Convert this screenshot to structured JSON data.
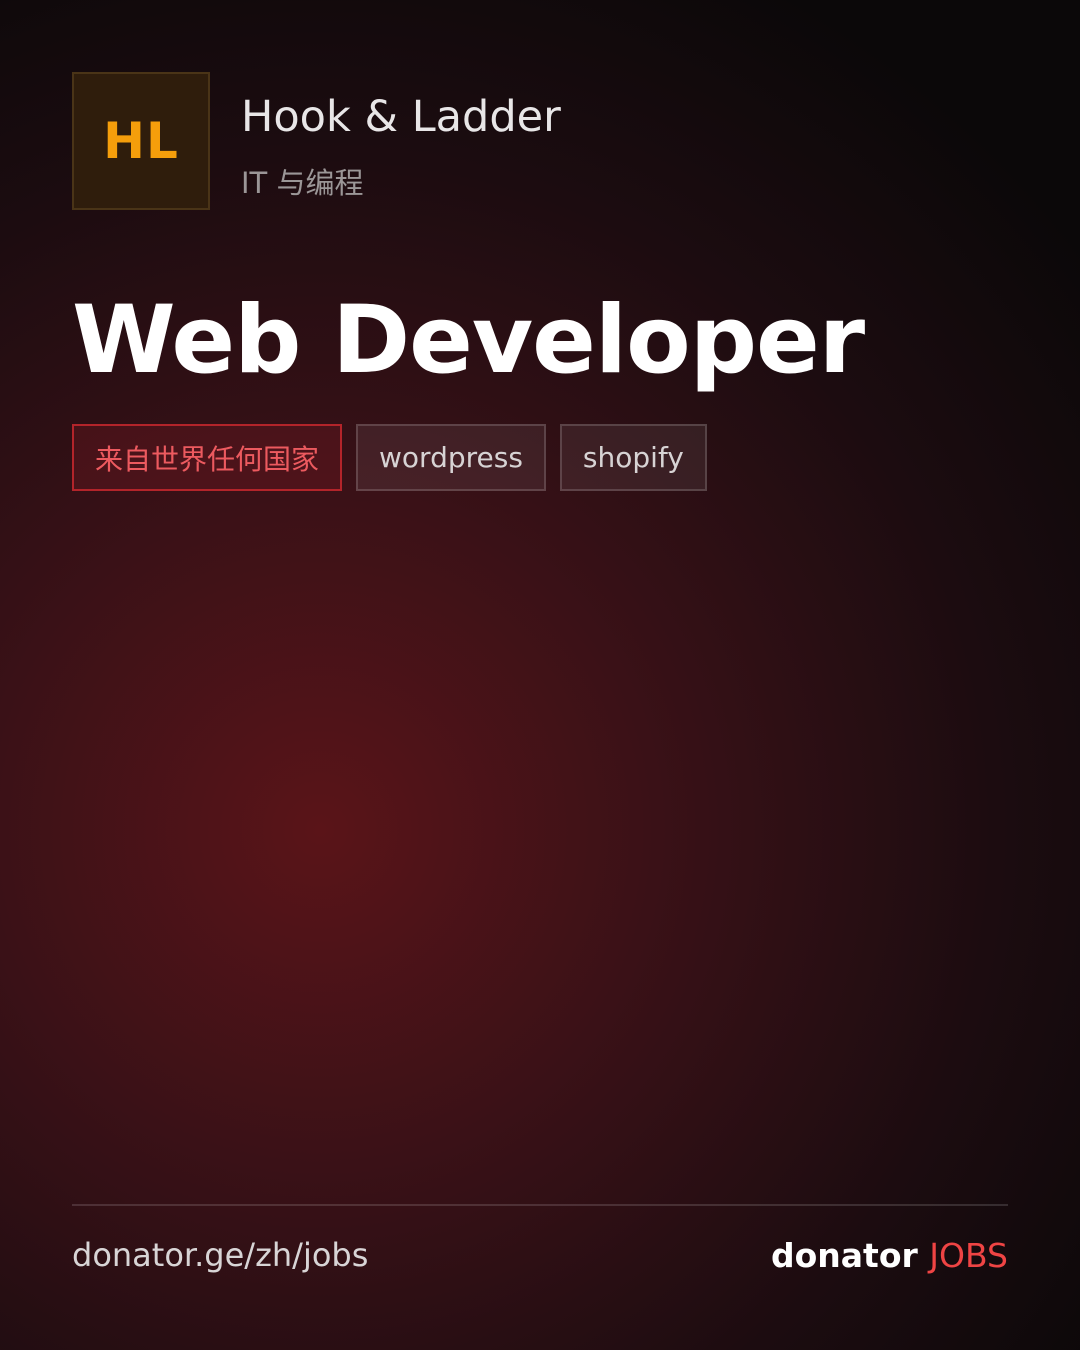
{
  "header": {
    "logo_text": "HL",
    "company_name": "Hook & Ladder",
    "category": "IT 与编程"
  },
  "job": {
    "title": "Web Developer",
    "tags": [
      {
        "label": "来自世界任何国家",
        "accent": true
      },
      {
        "label": "wordpress",
        "accent": false
      },
      {
        "label": "shopify",
        "accent": false
      }
    ]
  },
  "footer": {
    "url": "donator.ge/zh/jobs",
    "brand_name": "donator",
    "brand_accent": "JOBS"
  },
  "colors": {
    "logo_text": "#f59e0b",
    "accent": "#ef4444",
    "background_glow": "#5a1418"
  }
}
